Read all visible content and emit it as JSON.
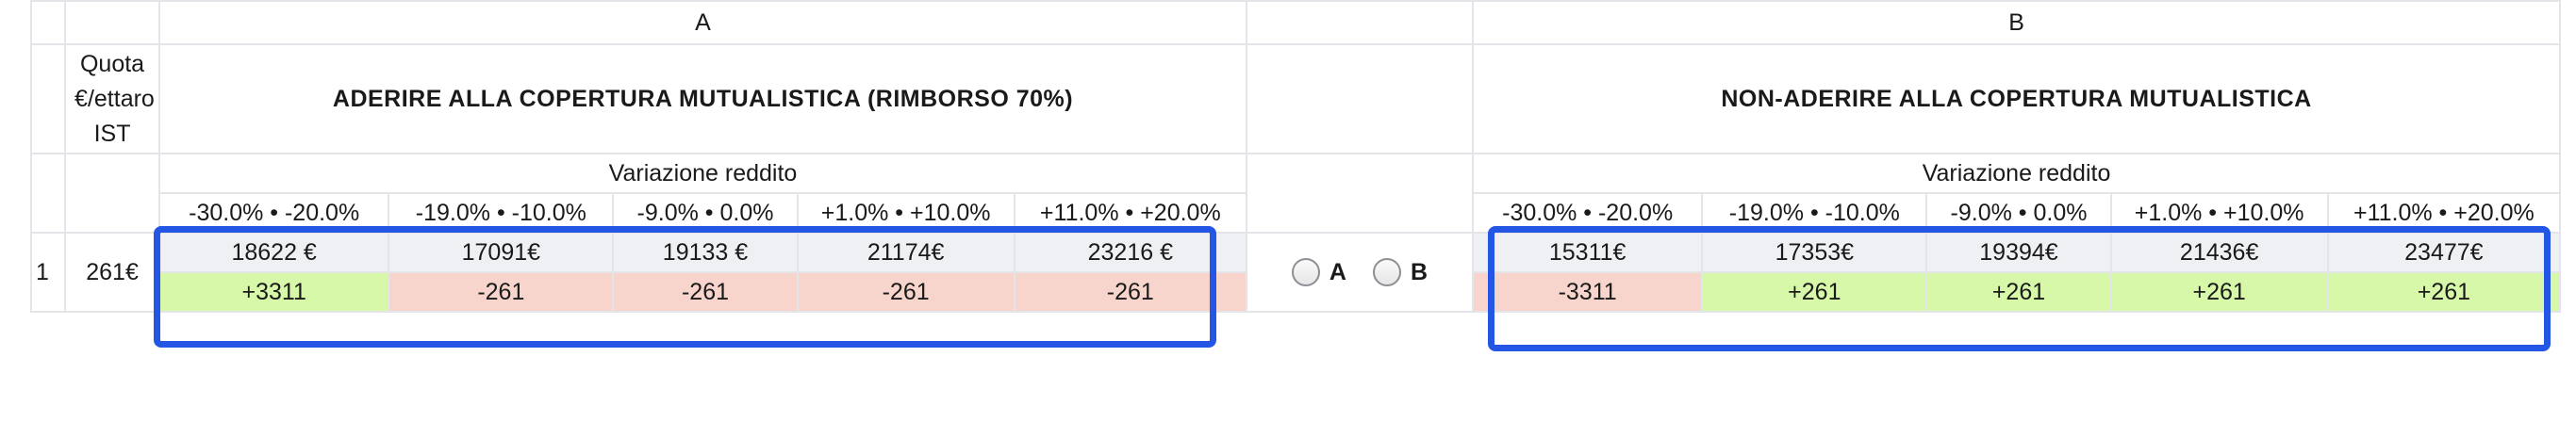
{
  "groups": {
    "a_label": "A",
    "b_label": "B"
  },
  "quota_header": "Quota €/ettaro IST",
  "option_a": {
    "title": "ADERIRE ALLA COPERTURA MUTUALISTICA (RIMBORSO 70%)"
  },
  "option_b": {
    "title": "NON-ADERIRE ALLA COPERTURA MUTUALISTICA"
  },
  "variazione_label": "Variazione reddito",
  "ranges": [
    "-30.0% • -20.0%",
    "-19.0% • -10.0%",
    "-9.0% • 0.0%",
    "+1.0% • +10.0%",
    "+11.0% • +20.0%"
  ],
  "rows": [
    {
      "index": "1",
      "quota": "261€",
      "a_values": [
        "18622 €",
        "17091€",
        "19133 €",
        "21174€",
        "23216 €"
      ],
      "a_diffs": [
        "+3311",
        "-261",
        "-261",
        "-261",
        "-261"
      ],
      "b_values": [
        "15311€",
        "17353€",
        "19394€",
        "21436€",
        "23477€"
      ],
      "b_diffs": [
        "-3311",
        "+261",
        "+261",
        "+261",
        "+261"
      ],
      "choice_a_label": "A",
      "choice_b_label": "B"
    }
  ],
  "colors": {
    "positive": "#d7f8a8",
    "negative": "#f7d5cc",
    "highlight": "#2456e6"
  }
}
